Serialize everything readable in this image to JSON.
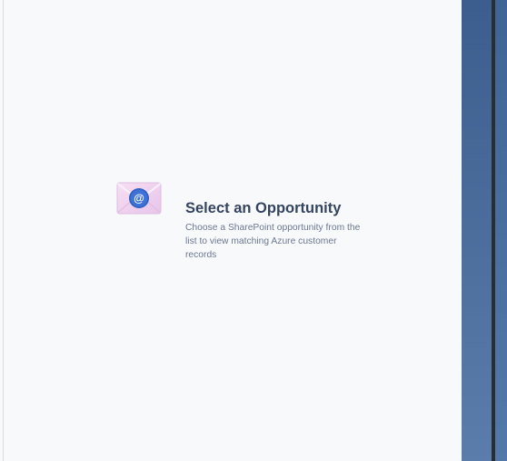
{
  "empty_state": {
    "icon": "email-at-icon",
    "title": "Select an Opportunity",
    "description": "Choose a SharePoint opportunity from the list to view matching Azure customer records"
  },
  "colors": {
    "panel_background": "#f8f9fb",
    "title_text": "#35455f",
    "description_text": "#6b7891",
    "envelope_badge": "#2f5fbf",
    "right_background": "#4d6f9e"
  }
}
